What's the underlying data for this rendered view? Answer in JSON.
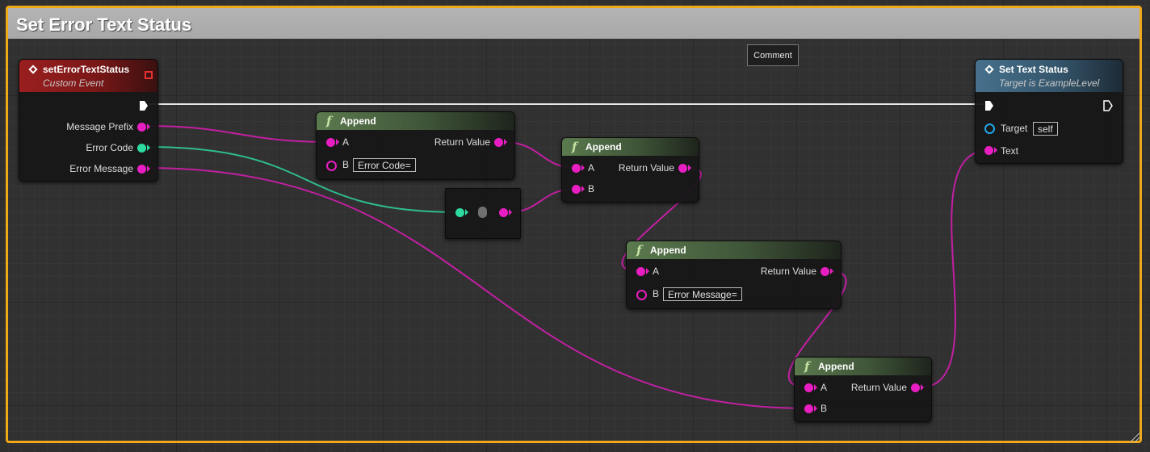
{
  "comment": {
    "title": "Set Error Text Status",
    "comment_button": "Comment",
    "border_color": "#f0a819"
  },
  "nodes": {
    "event": {
      "title": "setErrorTextStatus",
      "subtitle": "Custom Event",
      "header_color": "#9a1f1f",
      "outputs": [
        "Message Prefix",
        "Error Code",
        "Error Message"
      ],
      "icons": [
        "event-diamond-icon",
        "stop-icon",
        "exec-arrow-icon"
      ]
    },
    "append1": {
      "title": "Append",
      "pin_a": "A",
      "pin_b": "B",
      "b_value": "Error Code=",
      "return_label": "Return Value",
      "icon": "function-icon"
    },
    "append2": {
      "title": "Append",
      "pin_a": "A",
      "pin_b": "B",
      "return_label": "Return Value",
      "icon": "function-icon"
    },
    "append3": {
      "title": "Append",
      "pin_a": "A",
      "pin_b": "B",
      "b_value": "Error Message=",
      "return_label": "Return Value",
      "icon": "function-icon"
    },
    "append4": {
      "title": "Append",
      "pin_a": "A",
      "pin_b": "B",
      "return_label": "Return Value",
      "icon": "function-icon"
    },
    "set_text_status": {
      "title": "Set Text Status",
      "subtitle": "Target is ExampleLevel",
      "header_color": "#46708c",
      "target_label": "Target",
      "target_value": "self",
      "text_label": "Text"
    },
    "converter": {
      "icon": "conversion-icon"
    }
  },
  "colors": {
    "string_pin": "#e91ec2",
    "int_pin": "#2edaa0",
    "object_pin": "#23a6e8",
    "exec_wire": "#e6e6e6",
    "function_header": "#5b7a4e"
  }
}
